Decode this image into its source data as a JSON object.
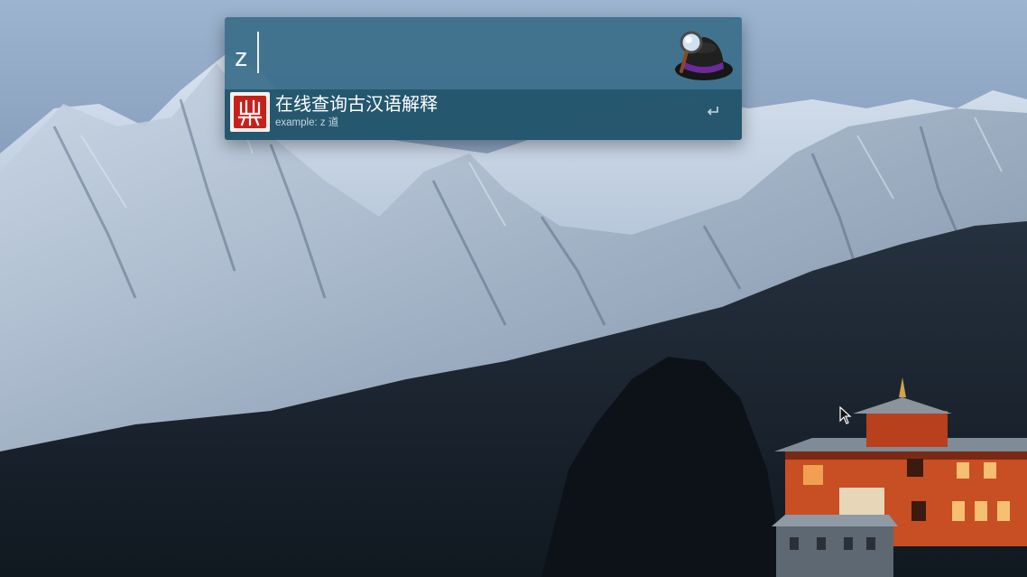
{
  "search": {
    "query": "z"
  },
  "results": [
    {
      "title": "在线查询古汉语解释",
      "subtitle": "example:   z 道",
      "icon": "dictionary-seal-icon",
      "action_icon": "return-key-icon"
    }
  ],
  "icons": {
    "app_logo": "alfred-hat-icon",
    "pointer": "mouse-pointer-icon"
  },
  "colors": {
    "launcher_bg": "#3a6e8a",
    "result_bg": "#22546b",
    "seal_red": "#c7201b"
  }
}
